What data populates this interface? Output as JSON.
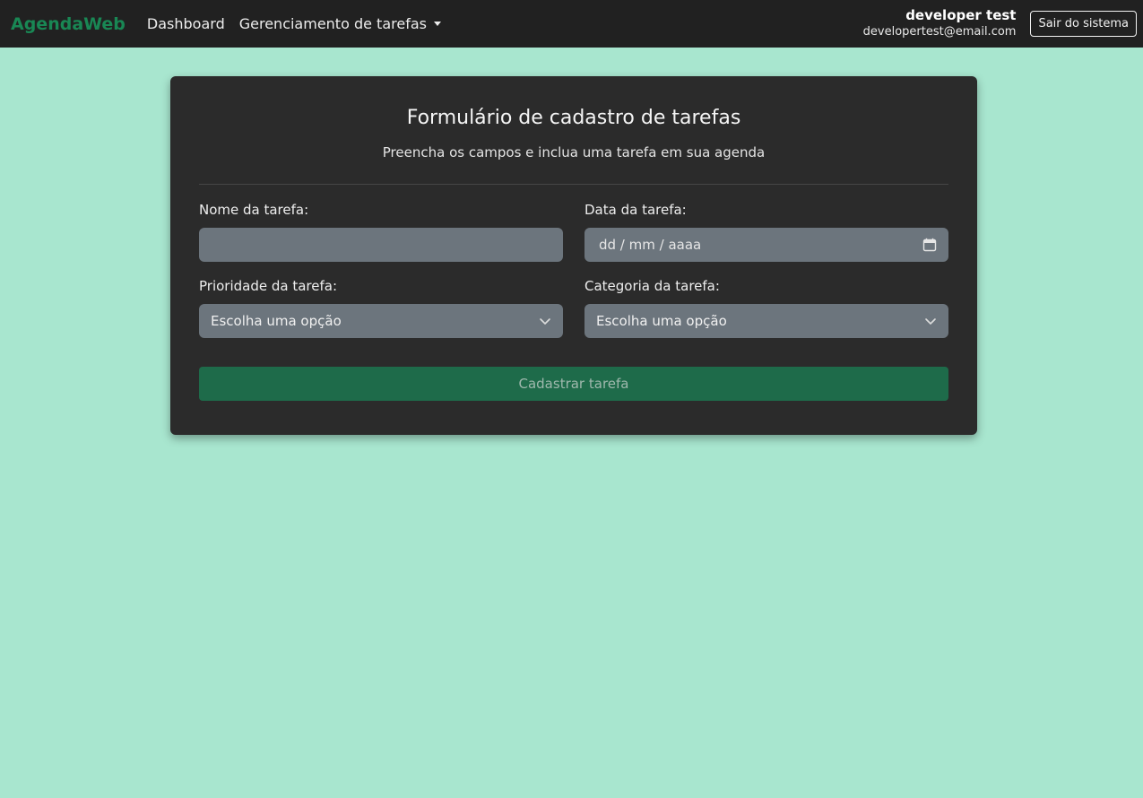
{
  "navbar": {
    "brand": "AgendaWeb",
    "links": {
      "dashboard": "Dashboard",
      "task_management": "Gerenciamento de tarefas"
    },
    "user": {
      "name": "developer test",
      "email": "developertest@email.com"
    },
    "logout_label": "Sair do sistema"
  },
  "form": {
    "title": "Formulário de cadastro de tarefas",
    "subtitle": "Preencha os campos e inclua uma tarefa em sua agenda",
    "fields": {
      "name": {
        "label": "Nome da tarefa:",
        "value": ""
      },
      "date": {
        "label": "Data da tarefa:",
        "placeholder": "dd / mm / aaaa"
      },
      "priority": {
        "label": "Prioridade da tarefa:",
        "selected": "Escolha uma opção"
      },
      "category": {
        "label": "Categoria da tarefa:",
        "selected": "Escolha uma opção"
      }
    },
    "submit_label": "Cadastrar tarefa"
  },
  "colors": {
    "page_background": "#a8e6cf",
    "navbar_background": "#212121",
    "brand": "#198754",
    "card_background": "#2b2b2b",
    "input_background": "#6c757d",
    "submit_background": "#1e6b4a"
  },
  "icons": {
    "dropdown_caret": "caret-down-icon",
    "date_picker": "calendar-icon",
    "select_arrow": "chevron-down-icon"
  }
}
